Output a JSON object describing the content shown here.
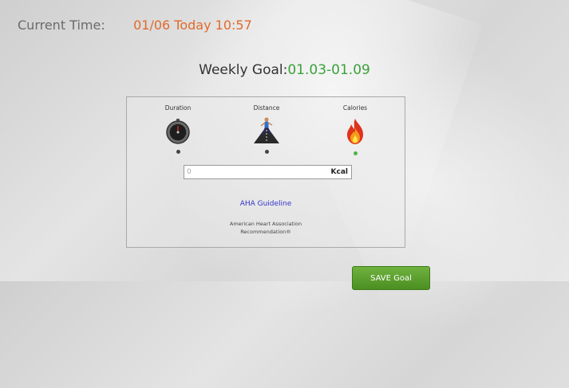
{
  "header": {
    "time_label": "Current Time:",
    "time_value": "01/06 Today 10:57"
  },
  "weekly_goal": {
    "label": "Weekly Goal:",
    "range": "01.03-01.09"
  },
  "goal_types": [
    {
      "label": "Duration",
      "icon": "stopwatch-icon",
      "selected": false
    },
    {
      "label": "Distance",
      "icon": "runner-road-icon",
      "selected": false
    },
    {
      "label": "Calories",
      "icon": "flame-icon",
      "selected": true
    }
  ],
  "goal_input": {
    "value": "0",
    "unit": "Kcal"
  },
  "guideline": {
    "link": "AHA Guideline",
    "line1": "American Heart Association",
    "line2": "Recommendation®"
  },
  "save_button": "SAVE Goal",
  "colors": {
    "time_value": "#e06a2a",
    "range": "#3aa13a",
    "link": "#3333cc",
    "button": "#5aa12f",
    "selected_dot": "#4db34d"
  }
}
